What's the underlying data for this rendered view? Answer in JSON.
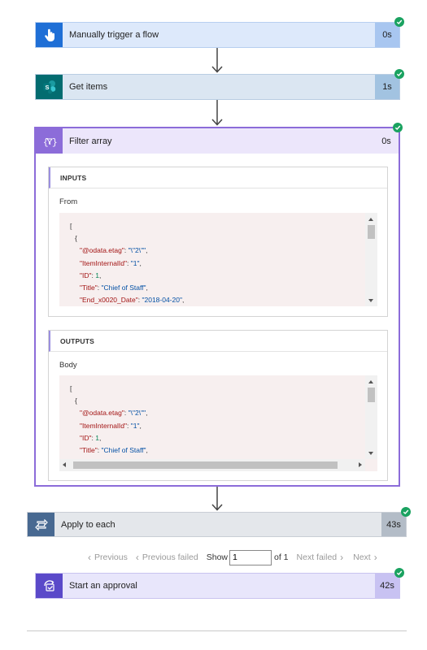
{
  "steps": {
    "trigger": {
      "title": "Manually trigger a flow",
      "duration": "0s",
      "icon": "hand-tap-icon",
      "color": "#1f6fd6"
    },
    "get_items": {
      "title": "Get items",
      "duration": "1s",
      "icon": "sharepoint-icon",
      "color": "#036c70"
    },
    "filter": {
      "title": "Filter array",
      "duration": "0s",
      "icon": "filter-expression-icon",
      "color": "#8c6cd9"
    },
    "apply": {
      "title": "Apply to each",
      "duration": "43s",
      "icon": "loop-icon",
      "color": "#486991"
    },
    "approval": {
      "title": "Start an approval",
      "duration": "42s",
      "icon": "approval-icon",
      "color": "#5a49c9"
    }
  },
  "filter_panel": {
    "inputs": {
      "header": "INPUTS",
      "label": "From",
      "code": [
        "[",
        "{",
        "\"@odata.etag\": \"\\\"2\\\"\",",
        "\"ItemInternalId\": \"1\",",
        "\"ID\": 1,",
        "\"Title\": \"Chief of Staff\",",
        "\"End_x0020_Date\": \"2018-04-20\","
      ]
    },
    "outputs": {
      "header": "OUTPUTS",
      "label": "Body",
      "code": [
        "[",
        "{",
        "\"@odata.etag\": \"\\\"2\\\"\",",
        "\"ItemInternalId\": \"1\",",
        "\"ID\": 1,",
        "\"Title\": \"Chief of Staff\","
      ]
    }
  },
  "pager": {
    "previous": "Previous",
    "previous_failed": "Previous failed",
    "show": "Show",
    "page_value": "1",
    "of": "of 1",
    "next_failed": "Next failed",
    "next": "Next"
  },
  "colors": {
    "success": "#1aa260",
    "trigger_bg": "#dde9fb",
    "trigger_dur": "#a8c6f0",
    "sharepoint_bg": "#dbe6f2",
    "sharepoint_dur": "#a2c3e1",
    "filter_bg": "#ece6fb",
    "filter_border": "#8c6cd9",
    "apply_bg": "#e4e7eb",
    "apply_dur": "#b3bcc7",
    "approval_bg": "#e8e6fb",
    "approval_dur": "#c8c2f2"
  }
}
